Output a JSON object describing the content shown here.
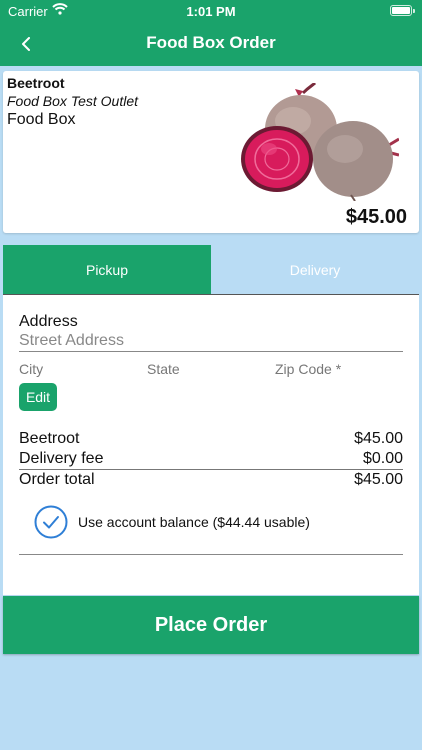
{
  "status_bar": {
    "carrier": "Carrier",
    "time": "1:01 PM"
  },
  "nav": {
    "title": "Food Box Order",
    "back_icon": "chevron-left-icon"
  },
  "product": {
    "name": "Beetroot",
    "outlet": "Food Box Test Outlet",
    "category": "Food Box",
    "price": "$45.00",
    "image_icon": "beetroot-image"
  },
  "tabs": [
    {
      "label": "Pickup",
      "active": true
    },
    {
      "label": "Delivery",
      "active": false
    }
  ],
  "address": {
    "label": "Address",
    "street_placeholder": "Street Address",
    "city_label": "City",
    "state_label": "State",
    "zip_label": "Zip Code *",
    "edit_label": "Edit"
  },
  "summary": {
    "item": {
      "label": "Beetroot",
      "value": "$45.00"
    },
    "fee": {
      "label": "Delivery fee",
      "value": "$0.00"
    },
    "total": {
      "label": "Order total",
      "value": "$45.00"
    }
  },
  "balance": {
    "text": "Use account balance ($44.44 usable)",
    "checked": true,
    "icon": "check-circle-icon"
  },
  "place_order": {
    "label": "Place Order"
  },
  "colors": {
    "primary": "#1aa36b",
    "background": "#b9dcf4",
    "check": "#2f7fd6"
  }
}
